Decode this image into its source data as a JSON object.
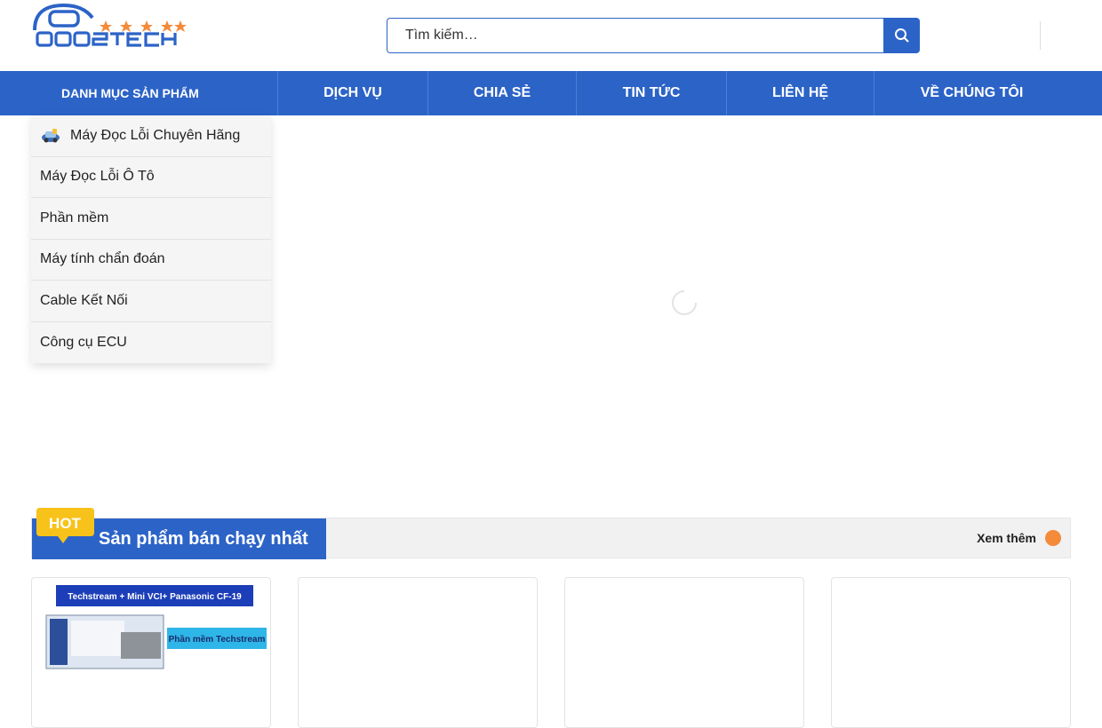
{
  "brand": {
    "logo_text": "OBD2TECH"
  },
  "search": {
    "placeholder": "Tìm kiếm…"
  },
  "nav": {
    "category_label": "DANH MỤC SẢN PHẨM",
    "items": [
      {
        "label": "DỊCH VỤ"
      },
      {
        "label": "CHIA SẺ"
      },
      {
        "label": "TIN TỨC"
      },
      {
        "label": "LIÊN HỆ"
      },
      {
        "label": "VỀ CHÚNG TÔI"
      }
    ]
  },
  "sidebar": {
    "items": [
      {
        "label": "Máy Đọc Lỗi Chuyên Hãng",
        "icon": "car-scanner-icon"
      },
      {
        "label": "Máy Đọc Lỗi Ô Tô"
      },
      {
        "label": "Phần mềm"
      },
      {
        "label": "Máy tính chẩn đoán"
      },
      {
        "label": "Cable Kết Nối"
      },
      {
        "label": "Công cụ ECU"
      }
    ]
  },
  "hot_section": {
    "badge": "HOT",
    "title": "Sản phẩm bán chạy nhất",
    "see_more": "Xem thêm"
  },
  "products": [
    {
      "banner_title": "Techstream + Mini VCI+ Panasonic CF-19",
      "banner_label": "Phần mềm Techstream"
    }
  ],
  "colors": {
    "primary": "#2c63c7",
    "accent_orange": "#f38b3a",
    "hot_badge": "#f7c21a"
  }
}
